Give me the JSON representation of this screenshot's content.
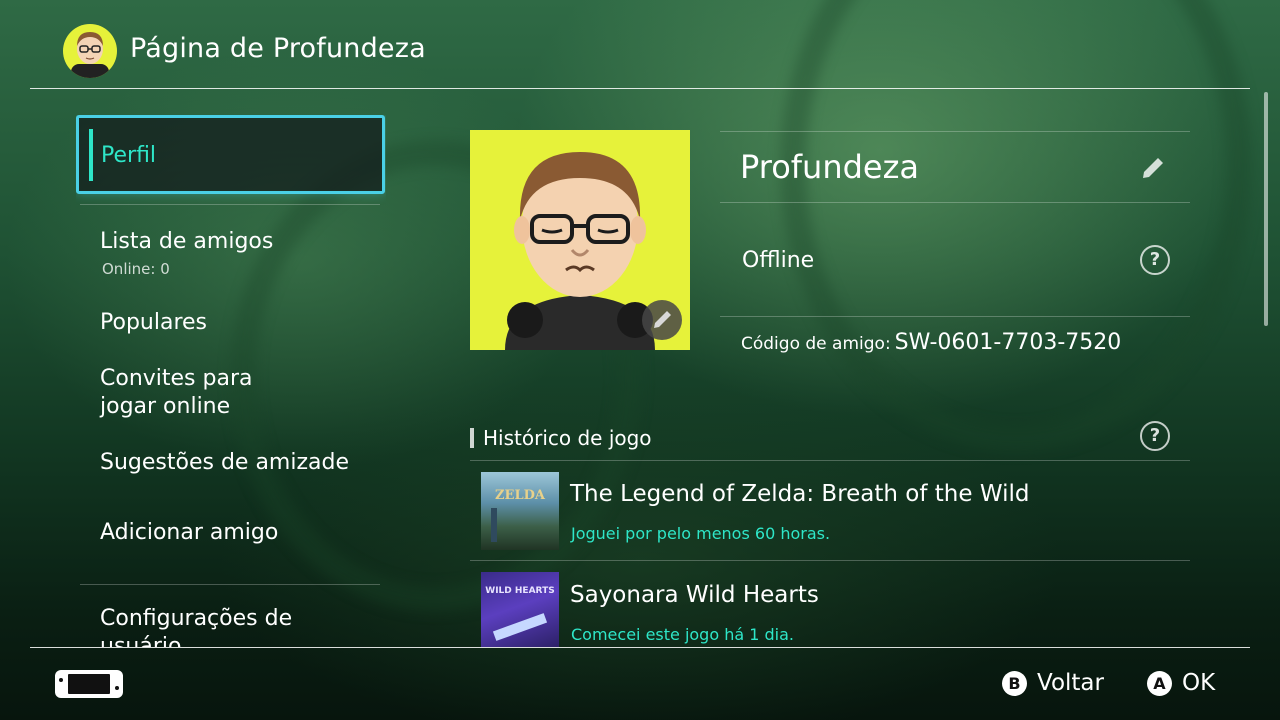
{
  "header": {
    "title": "Página de Profundeza"
  },
  "sidebar": {
    "items": [
      {
        "label": "Perfil",
        "selected": true
      },
      {
        "label": "Lista de amigos",
        "sub": "Online: 0"
      },
      {
        "label": "Populares"
      },
      {
        "label": "Convites para\njogar online"
      },
      {
        "label": "Sugestões de amizade"
      },
      {
        "label": "Adicionar amigo"
      },
      {
        "label": "Configurações de usuário"
      }
    ]
  },
  "profile": {
    "name": "Profundeza",
    "status": "Offline",
    "friend_code_label": "Código de amigo",
    "friend_code": "SW-0601-7703-7520"
  },
  "history": {
    "title": "Histórico de jogo",
    "games": [
      {
        "title": "The Legend of Zelda: Breath of the Wild",
        "note": "Joguei por pelo menos 60 horas.",
        "thumb_text": "ZELDA"
      },
      {
        "title": "Sayonara Wild Hearts",
        "note": "Comecei este jogo há 1 dia.",
        "thumb_text": "WILD HEARTS"
      }
    ]
  },
  "footer": {
    "back_key": "B",
    "back_label": "Voltar",
    "ok_key": "A",
    "ok_label": "OK"
  },
  "icons": [
    "avatar",
    "pencil-icon",
    "help-icon",
    "switch-console-icon"
  ],
  "colors": {
    "accent_teal": "#2ee6c8",
    "focus_cyan": "#4ad0e6",
    "avatar_bg": "#e6f23a"
  }
}
